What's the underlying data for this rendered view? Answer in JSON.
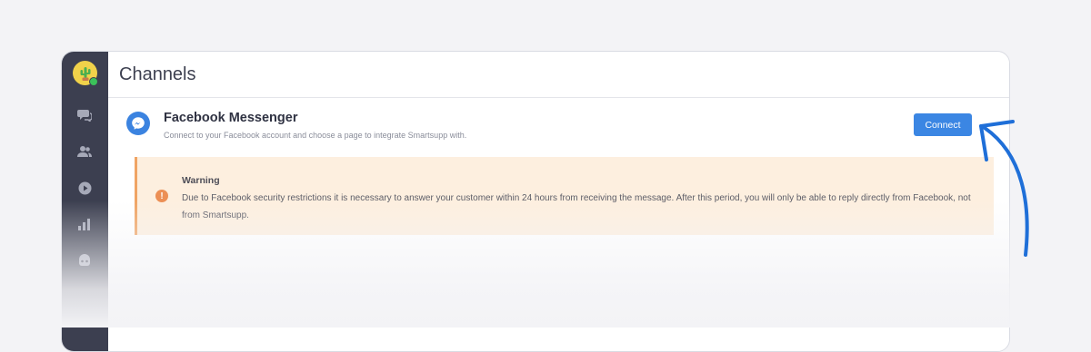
{
  "header": {
    "title": "Channels"
  },
  "sidebar": {
    "icons": [
      "cactus-avatar",
      "chat-icon",
      "contacts-icon",
      "play-icon",
      "stats-icon",
      "bot-icon"
    ]
  },
  "channel": {
    "name": "Facebook Messenger",
    "description": "Connect to your Facebook account and choose a page to integrate Smartsupp with.",
    "connect_label": "Connect"
  },
  "warning": {
    "icon": "!",
    "title": "Warning",
    "text": "Due to Facebook security restrictions it is necessary to answer your customer within 24 hours from receiving the message. After this period, you will only be able to reply directly from Facebook, not from Smartsupp."
  },
  "colors": {
    "accent": "#3b86e3",
    "sidebar": "#3c3f50",
    "warning_bg": "#fdefdf",
    "warning_border": "#f0a464",
    "annotation_arrow": "#1f6fd8"
  }
}
